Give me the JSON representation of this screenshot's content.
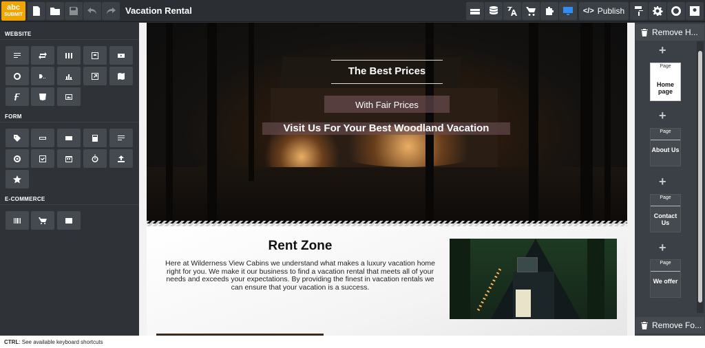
{
  "app": {
    "logo_top": "abc",
    "logo_bottom": "SUBMIT",
    "title": "Vacation Rental"
  },
  "toolbar": {
    "left_icons": [
      "new-page-icon",
      "folder-icon",
      "save-icon",
      "undo-icon",
      "redo-icon"
    ],
    "right_icons": [
      "layers-icon",
      "database-icon",
      "translate-icon",
      "cart-icon",
      "puzzle-icon",
      "desktop-icon"
    ],
    "publish_label": "Publish",
    "publish_code": "</>",
    "end_icons": [
      "paint-roller-icon",
      "gear-icon",
      "globe-icon",
      "user-icon"
    ],
    "active_color": "#2f8ef4"
  },
  "sidebar": {
    "sections": [
      {
        "title": "WEBSITE",
        "widgets": [
          "text-icon",
          "slider-icon",
          "columns-icon",
          "image-block-icon",
          "video-icon",
          "globe-icon",
          "breadcrumb-icon",
          "chart-icon",
          "embed-icon",
          "map-icon",
          "font-icon",
          "html5-icon",
          "gallery-icon"
        ]
      },
      {
        "title": "FORM",
        "widgets": [
          "tag-icon",
          "input-icon",
          "textbox-icon",
          "calculator-icon",
          "form-text-icon",
          "radio-icon",
          "checkbox-icon",
          "calendar-icon",
          "timer-icon",
          "upload-icon",
          "star-icon"
        ]
      },
      {
        "title": "E-COMMERCE",
        "widgets": [
          "barcode-icon",
          "cart-icon",
          "credit-card-icon"
        ]
      }
    ]
  },
  "hero": {
    "title": "The Best Prices",
    "subtitle": "With Fair Prices",
    "tagline": "Visit Us For Your Best Woodland Vacation"
  },
  "rent": {
    "title": "Rent Zone",
    "body": "Here at Wilderness View Cabins we understand what makes a luxury vacation home right for you. We make it our business to find a vacation rental that meets all of your needs and exceeds your expectations. By providing the finest in vacation rentals we can ensure that your vacation is a success."
  },
  "right_panel": {
    "remove_header_label": "Remove H...",
    "remove_footer_label": "Remove Fo...",
    "page_caption": "Page",
    "pages": [
      "Home page",
      "About Us",
      "Contact Us",
      "We offer"
    ]
  },
  "status": {
    "key": "CTRL",
    "text": ": See available keyboard shortcuts"
  }
}
